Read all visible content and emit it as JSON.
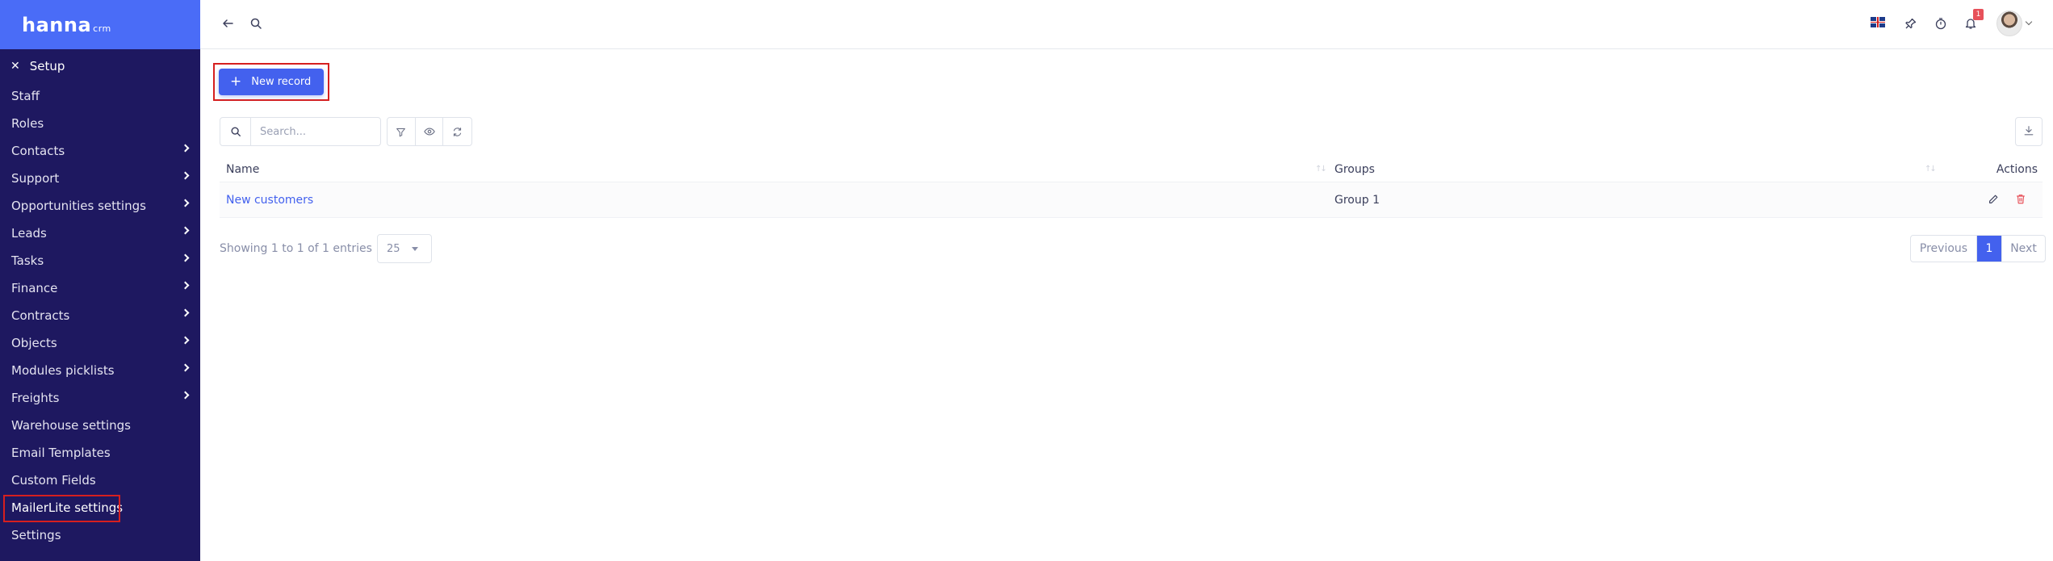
{
  "brand": {
    "logo_main": "hanna",
    "logo_sub": "crm"
  },
  "sidebar": {
    "section_title": "Setup",
    "items": [
      {
        "label": "Staff",
        "has_children": false
      },
      {
        "label": "Roles",
        "has_children": false
      },
      {
        "label": "Contacts",
        "has_children": true
      },
      {
        "label": "Support",
        "has_children": true
      },
      {
        "label": "Opportunities settings",
        "has_children": true
      },
      {
        "label": "Leads",
        "has_children": true
      },
      {
        "label": "Tasks",
        "has_children": true
      },
      {
        "label": "Finance",
        "has_children": true
      },
      {
        "label": "Contracts",
        "has_children": true
      },
      {
        "label": "Objects",
        "has_children": true
      },
      {
        "label": "Modules picklists",
        "has_children": true
      },
      {
        "label": "Freights",
        "has_children": true
      },
      {
        "label": "Warehouse settings",
        "has_children": false
      },
      {
        "label": "Email Templates",
        "has_children": false
      },
      {
        "label": "Custom Fields",
        "has_children": false
      },
      {
        "label": "MailerLite settings",
        "has_children": false,
        "highlighted": true
      },
      {
        "label": "Settings",
        "has_children": false
      }
    ]
  },
  "topbar": {
    "notification_count": "1",
    "icons": [
      "back-arrow-icon",
      "search-icon",
      "uk-flag-icon",
      "pin-icon",
      "timer-icon",
      "bell-icon",
      "avatar"
    ]
  },
  "toolbar": {
    "new_record_label": "New record",
    "search_placeholder": "Search..."
  },
  "table": {
    "columns": [
      "Name",
      "Groups",
      "Actions"
    ],
    "rows": [
      {
        "name": "New customers",
        "groups": "Group 1"
      }
    ]
  },
  "footer": {
    "showing": "Showing 1 to 1 of 1 entries",
    "page_size": "25",
    "previous_label": "Previous",
    "current_page": "1",
    "next_label": "Next"
  },
  "colors": {
    "sidebar_bg": "#1e1860",
    "brand_bg": "#4a6cf7",
    "primary": "#4361ee",
    "danger": "#e7515a",
    "highlight_border": "#d61f1f"
  }
}
